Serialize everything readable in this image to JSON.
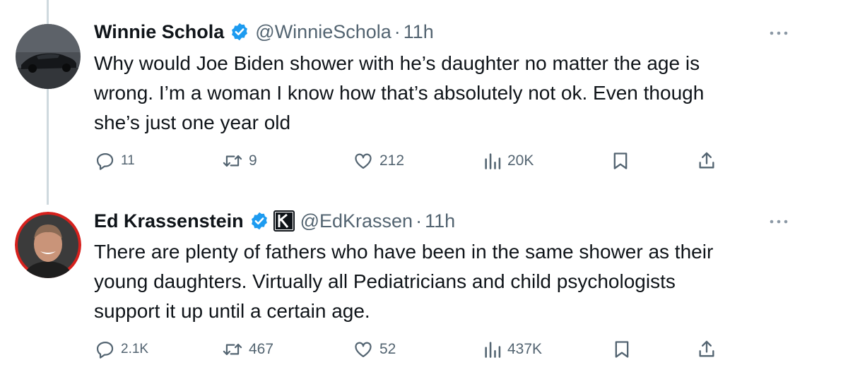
{
  "tweets": [
    {
      "author_name": "Winnie Schola",
      "handle": "@WinnieSchola",
      "dot": "·",
      "time": "11h",
      "text_lines": [
        "Why would Joe Biden shower with he’s daughter no matter the age is",
        "wrong. I’m a woman I know how that’s absolutely not ok. Even though",
        "she’s just one year old"
      ],
      "replies": "11",
      "reposts": "9",
      "likes": "212",
      "views": "20K",
      "icons": [
        "verified-badge-icon",
        "more-icon",
        "reply-icon",
        "repost-icon",
        "like-icon",
        "views-icon",
        "bookmark-icon",
        "share-icon"
      ]
    },
    {
      "author_name": "Ed Krassenstein",
      "handle": "@EdKrassen",
      "dot": "·",
      "time": "11h",
      "affiliate_logo": "K",
      "text_lines": [
        "There are plenty of fathers who have been in the same shower as their",
        "young daughters.  Virtually all Pediatricians and child psychologists",
        "support it up until a certain age."
      ],
      "replies": "2.1K",
      "reposts": "467",
      "likes": "52",
      "views": "437K",
      "icons": [
        "verified-badge-icon",
        "affiliate-badge-icon",
        "more-icon",
        "reply-icon",
        "repost-icon",
        "like-icon",
        "views-icon",
        "bookmark-icon",
        "share-icon"
      ]
    }
  ],
  "colors": {
    "text": "#0f1419",
    "secondary": "#536471",
    "verified": "#1d9bf0",
    "thread_line": "#cfd9de"
  }
}
